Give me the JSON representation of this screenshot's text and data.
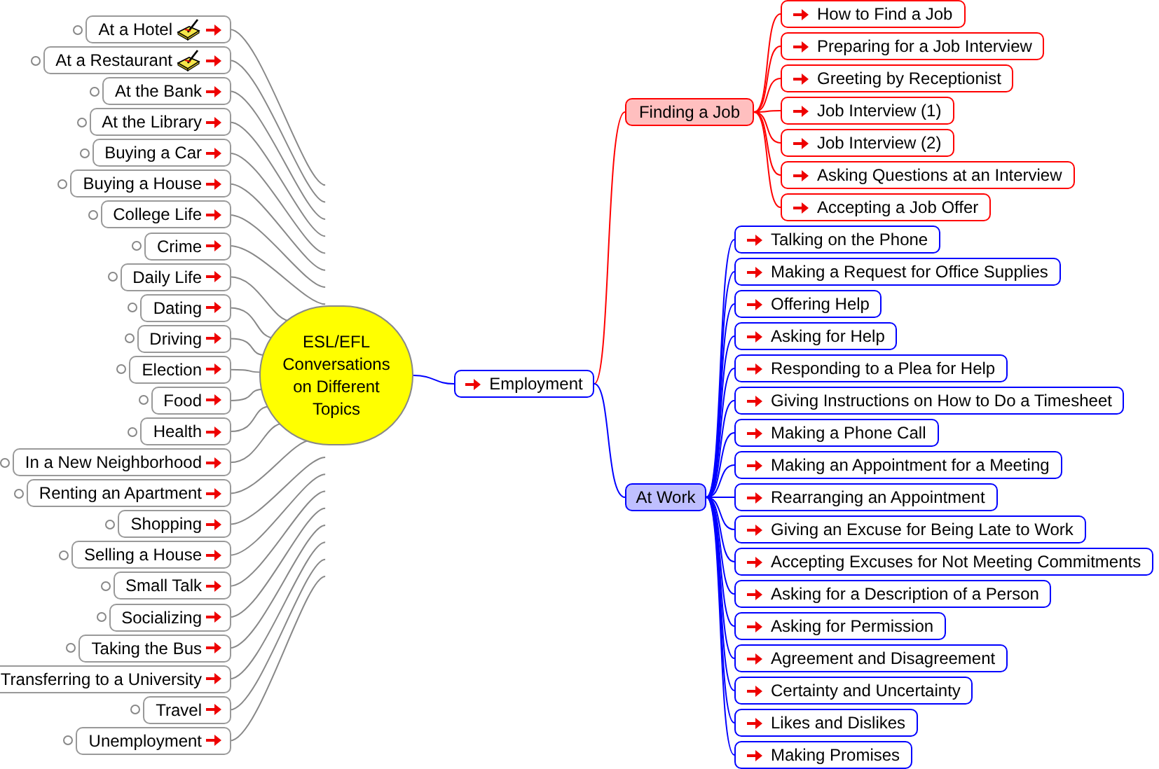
{
  "central_topic": {
    "label": "ESL/EFL Conversations on Different Topics"
  },
  "left_topics": [
    {
      "label": "At a Hotel",
      "has_note": true
    },
    {
      "label": "At a Restaurant",
      "has_note": true
    },
    {
      "label": "At the Bank",
      "has_note": false
    },
    {
      "label": "At the Library",
      "has_note": false
    },
    {
      "label": "Buying a Car",
      "has_note": false
    },
    {
      "label": "Buying a House",
      "has_note": false
    },
    {
      "label": "College Life",
      "has_note": false
    },
    {
      "label": "Crime",
      "has_note": false
    },
    {
      "label": "Daily Life",
      "has_note": false
    },
    {
      "label": "Dating",
      "has_note": false
    },
    {
      "label": "Driving",
      "has_note": false
    },
    {
      "label": "Election",
      "has_note": false
    },
    {
      "label": "Food",
      "has_note": false
    },
    {
      "label": "Health",
      "has_note": false
    },
    {
      "label": "In a New Neighborhood",
      "has_note": false
    },
    {
      "label": "Renting an Apartment",
      "has_note": false
    },
    {
      "label": "Shopping",
      "has_note": false
    },
    {
      "label": "Selling a House",
      "has_note": false
    },
    {
      "label": "Small Talk",
      "has_note": false
    },
    {
      "label": "Socializing",
      "has_note": false
    },
    {
      "label": "Taking the Bus",
      "has_note": false
    },
    {
      "label": "Transferring to a University",
      "has_note": false
    },
    {
      "label": "Travel",
      "has_note": false
    },
    {
      "label": "Unemployment",
      "has_note": false
    }
  ],
  "employment": {
    "label": "Employment",
    "branches": [
      {
        "label": "Finding a Job",
        "color": "#ff0000",
        "children": [
          "How to Find a Job",
          "Preparing for a Job Interview",
          "Greeting by Receptionist",
          "Job Interview (1)",
          "Job Interview (2)",
          "Asking Questions at an Interview",
          "Accepting a Job Offer"
        ]
      },
      {
        "label": "At Work",
        "color": "#0000ff",
        "children": [
          "Talking on the Phone",
          "Making a Request for Office Supplies",
          "Offering Help",
          "Asking for Help",
          "Responding to a Plea for Help",
          "Giving Instructions on How to Do a Timesheet",
          "Making a Phone Call",
          "Making an Appointment for a Meeting",
          "Rearranging an Appointment",
          "Giving an Excuse for Being Late to Work",
          "Accepting Excuses for Not Meeting Commitments",
          "Asking for a Description of a Person",
          "Asking for Permission",
          "Agreement and Disagreement",
          "Certainty and Uncertainty",
          "Likes and Dislikes",
          "Making Promises"
        ]
      }
    ]
  }
}
